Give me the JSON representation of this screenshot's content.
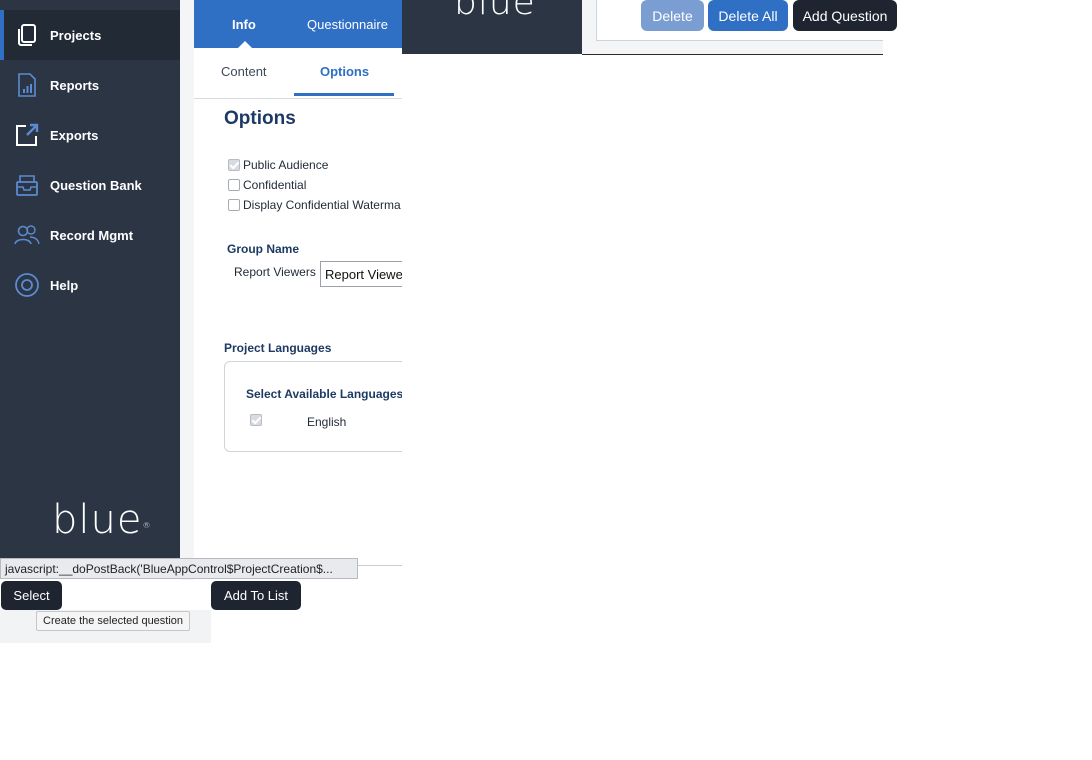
{
  "sidebar": {
    "items": [
      {
        "label": "Projects",
        "icon": "projects-icon",
        "active": true
      },
      {
        "label": "Reports",
        "icon": "reports-icon"
      },
      {
        "label": "Exports",
        "icon": "exports-icon"
      },
      {
        "label": "Question Bank",
        "icon": "question-bank-icon"
      },
      {
        "label": "Record Mgmt",
        "icon": "record-mgmt-icon"
      },
      {
        "label": "Help",
        "icon": "help-icon"
      }
    ],
    "logo": "blue"
  },
  "main": {
    "tabs": [
      {
        "label": "Info"
      },
      {
        "label": "Questionnaire"
      }
    ],
    "subtabs": [
      {
        "label": "Content"
      },
      {
        "label": "Options"
      }
    ],
    "title": "Options",
    "checkboxes": [
      {
        "label": "Public Audience",
        "checked": true
      },
      {
        "label": "Confidential",
        "checked": false
      },
      {
        "label": "Display Confidential Waterma",
        "checked": false
      }
    ],
    "group_name_heading": "Group Name",
    "report_viewers_label": "Report Viewers",
    "report_viewers_value": "Report Viewe",
    "project_languages_heading": "Project Languages",
    "select_languages_heading": "Select Available Languages",
    "language": {
      "label": "English",
      "checked": true
    }
  },
  "status_bar": "javascript:__doPostBack('BlueAppControl$ProjectCreation$...",
  "bottom": {
    "select_label": "Select",
    "add_to_list_label": "Add To List",
    "tooltip": "Create the selected question"
  },
  "top_right": {
    "logo": "blue",
    "delete_label": "Delete",
    "delete_all_label": "Delete All",
    "add_question_label": "Add Question"
  },
  "colors": {
    "accent": "#2f6fc4",
    "sidebar": "#2b3544",
    "heading": "#1e3a64"
  }
}
